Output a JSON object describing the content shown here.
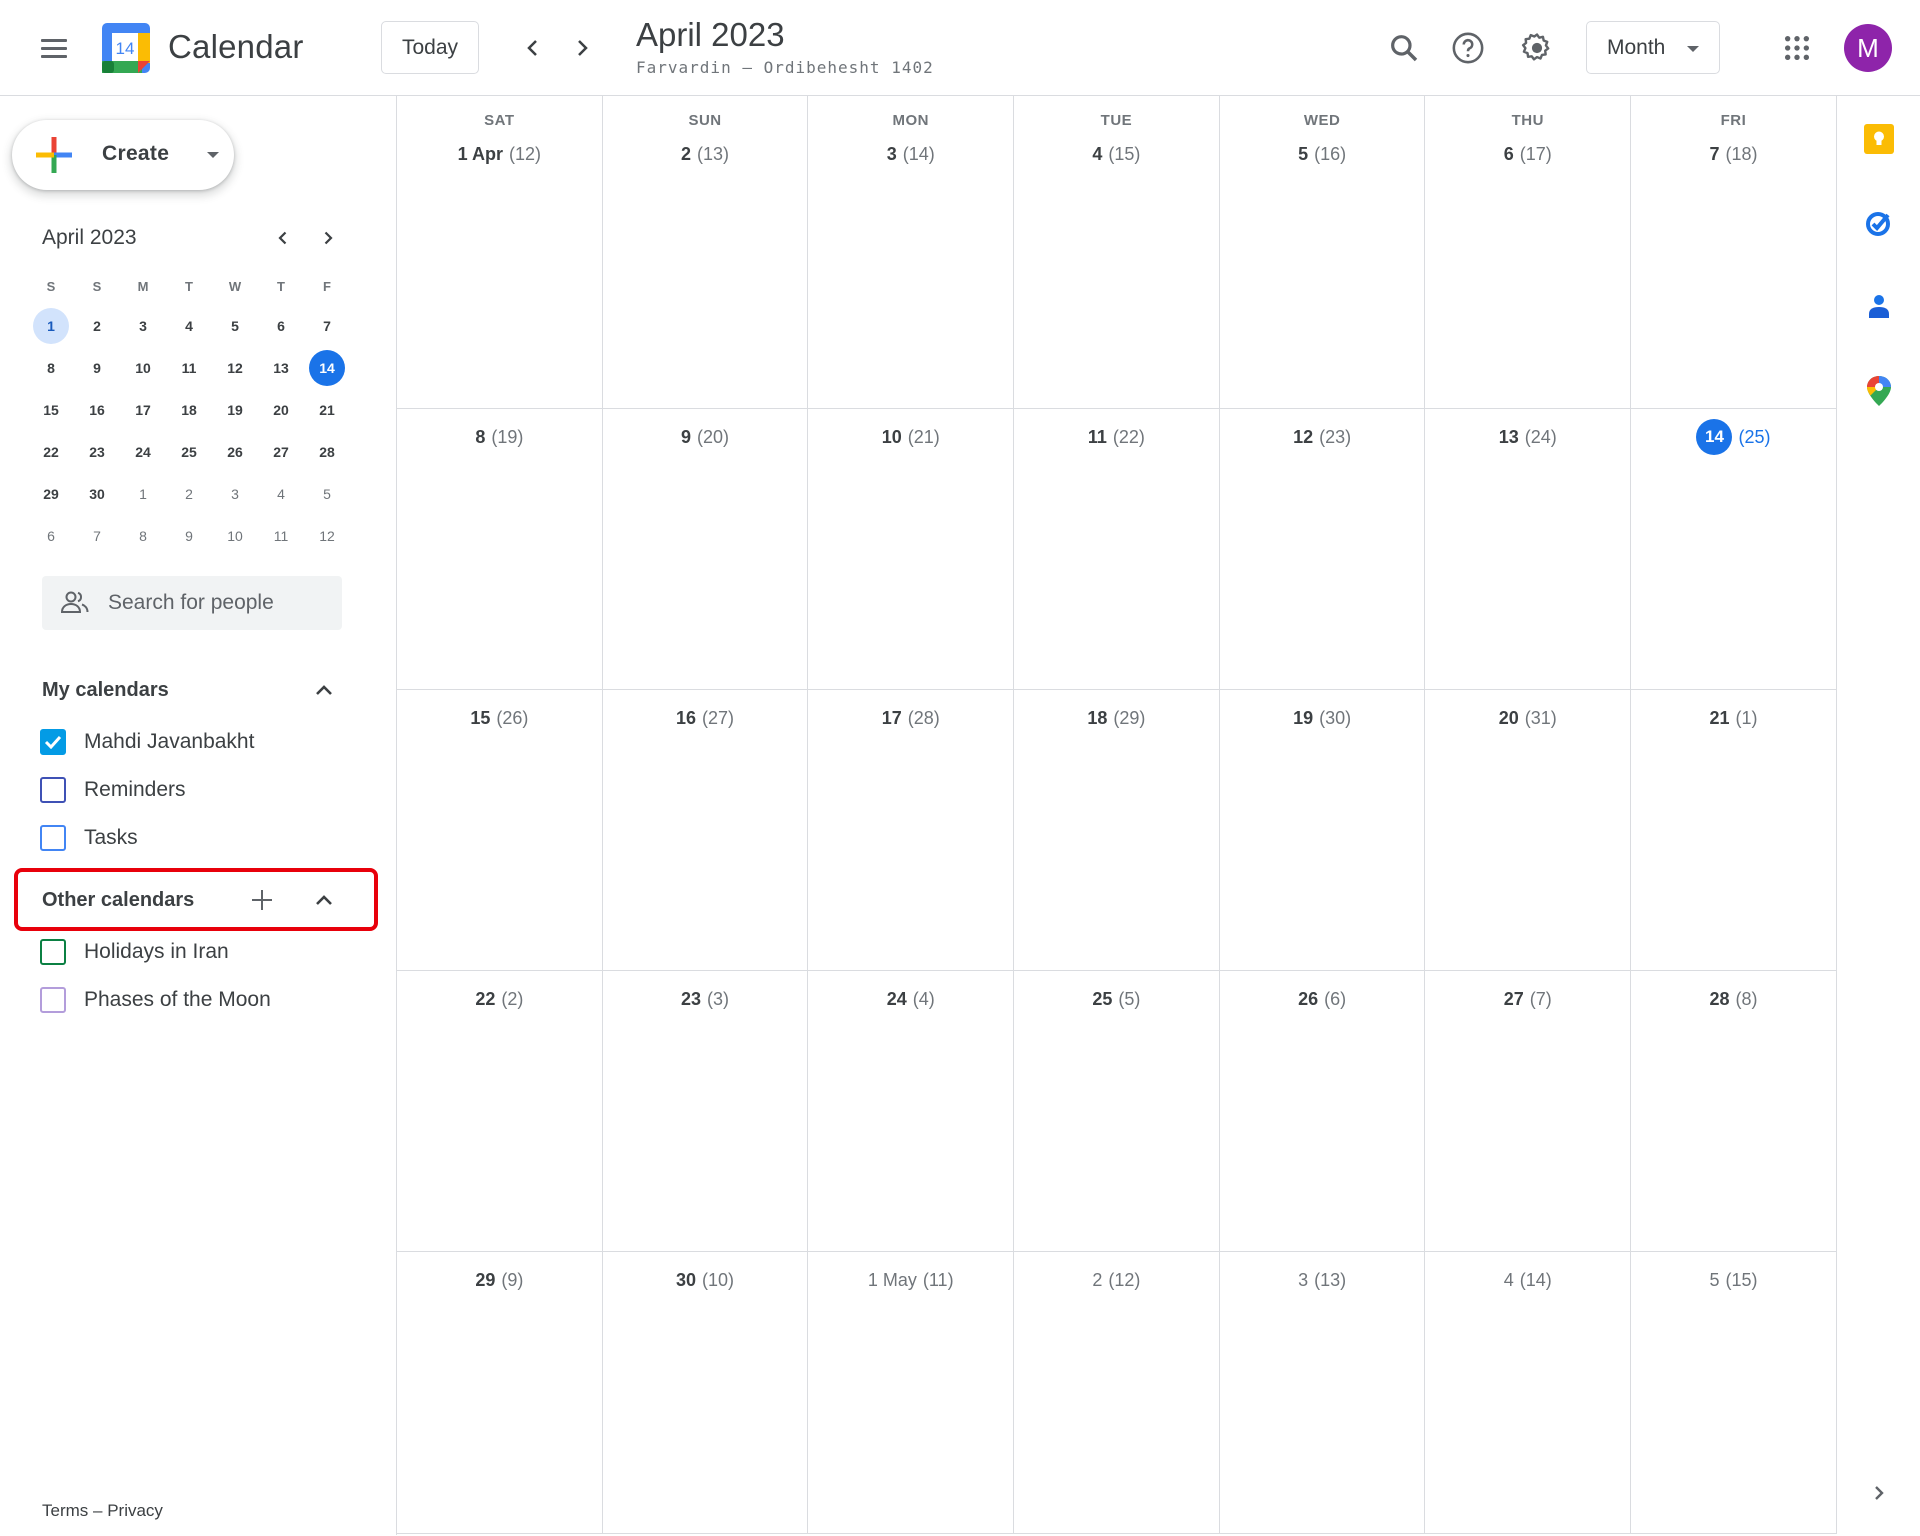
{
  "header": {
    "app_name": "Calendar",
    "logo_day": "14",
    "today_label": "Today",
    "title": "April 2023",
    "subtitle": "Farvardin – Ordibehesht 1402",
    "view_selector": "Month",
    "avatar_initial": "M",
    "icons": [
      "menu-icon",
      "chevron-left-icon",
      "chevron-right-icon",
      "search-icon",
      "help-icon",
      "settings-icon",
      "apps-grid-icon"
    ]
  },
  "sidebar": {
    "create_label": "Create",
    "mini_calendar": {
      "title": "April 2023",
      "weekday_headers": [
        "S",
        "S",
        "M",
        "T",
        "W",
        "T",
        "F"
      ],
      "weeks": [
        [
          {
            "d": "1",
            "state": "selected"
          },
          {
            "d": "2"
          },
          {
            "d": "3"
          },
          {
            "d": "4"
          },
          {
            "d": "5"
          },
          {
            "d": "6"
          },
          {
            "d": "7"
          }
        ],
        [
          {
            "d": "8"
          },
          {
            "d": "9"
          },
          {
            "d": "10"
          },
          {
            "d": "11"
          },
          {
            "d": "12"
          },
          {
            "d": "13"
          },
          {
            "d": "14",
            "state": "today"
          }
        ],
        [
          {
            "d": "15"
          },
          {
            "d": "16"
          },
          {
            "d": "17"
          },
          {
            "d": "18"
          },
          {
            "d": "19"
          },
          {
            "d": "20"
          },
          {
            "d": "21"
          }
        ],
        [
          {
            "d": "22"
          },
          {
            "d": "23"
          },
          {
            "d": "24"
          },
          {
            "d": "25"
          },
          {
            "d": "26"
          },
          {
            "d": "27"
          },
          {
            "d": "28"
          }
        ],
        [
          {
            "d": "29"
          },
          {
            "d": "30"
          },
          {
            "d": "1",
            "state": "other"
          },
          {
            "d": "2",
            "state": "other"
          },
          {
            "d": "3",
            "state": "other"
          },
          {
            "d": "4",
            "state": "other"
          },
          {
            "d": "5",
            "state": "other"
          }
        ],
        [
          {
            "d": "6",
            "state": "other"
          },
          {
            "d": "7",
            "state": "other"
          },
          {
            "d": "8",
            "state": "other"
          },
          {
            "d": "9",
            "state": "other"
          },
          {
            "d": "10",
            "state": "other"
          },
          {
            "d": "11",
            "state": "other"
          },
          {
            "d": "12",
            "state": "other"
          }
        ]
      ]
    },
    "people_search_placeholder": "Search for people",
    "my_calendars": {
      "label": "My calendars",
      "items": [
        {
          "name": "Mahdi Javanbakht",
          "checked": true,
          "color": "#039be5"
        },
        {
          "name": "Reminders",
          "checked": false,
          "color": "#3f51b5"
        },
        {
          "name": "Tasks",
          "checked": false,
          "color": "#4285f4"
        }
      ]
    },
    "other_calendars": {
      "label": "Other calendars",
      "items": [
        {
          "name": "Holidays in Iran",
          "checked": false,
          "color": "#0b8043"
        },
        {
          "name": "Phases of the Moon",
          "checked": false,
          "color": "#b39ddb"
        }
      ]
    },
    "footer": {
      "terms": "Terms",
      "separator": " – ",
      "privacy": "Privacy"
    }
  },
  "month_grid": {
    "weekday_headers": [
      "SAT",
      "SUN",
      "MON",
      "TUE",
      "WED",
      "THU",
      "FRI"
    ],
    "weeks": [
      [
        {
          "g": "1 Apr",
          "p": "(12)"
        },
        {
          "g": "2",
          "p": "(13)"
        },
        {
          "g": "3",
          "p": "(14)"
        },
        {
          "g": "4",
          "p": "(15)"
        },
        {
          "g": "5",
          "p": "(16)"
        },
        {
          "g": "6",
          "p": "(17)"
        },
        {
          "g": "7",
          "p": "(18)"
        }
      ],
      [
        {
          "g": "8",
          "p": "(19)"
        },
        {
          "g": "9",
          "p": "(20)"
        },
        {
          "g": "10",
          "p": "(21)"
        },
        {
          "g": "11",
          "p": "(22)"
        },
        {
          "g": "12",
          "p": "(23)"
        },
        {
          "g": "13",
          "p": "(24)"
        },
        {
          "g": "14",
          "p": "(25)",
          "state": "today"
        }
      ],
      [
        {
          "g": "15",
          "p": "(26)"
        },
        {
          "g": "16",
          "p": "(27)"
        },
        {
          "g": "17",
          "p": "(28)"
        },
        {
          "g": "18",
          "p": "(29)"
        },
        {
          "g": "19",
          "p": "(30)"
        },
        {
          "g": "20",
          "p": "(31)"
        },
        {
          "g": "21",
          "p": "(1)"
        }
      ],
      [
        {
          "g": "22",
          "p": "(2)"
        },
        {
          "g": "23",
          "p": "(3)"
        },
        {
          "g": "24",
          "p": "(4)"
        },
        {
          "g": "25",
          "p": "(5)"
        },
        {
          "g": "26",
          "p": "(6)"
        },
        {
          "g": "27",
          "p": "(7)"
        },
        {
          "g": "28",
          "p": "(8)"
        }
      ],
      [
        {
          "g": "29",
          "p": "(9)"
        },
        {
          "g": "30",
          "p": "(10)"
        },
        {
          "g": "1 May",
          "p": "(11)",
          "state": "other"
        },
        {
          "g": "2",
          "p": "(12)",
          "state": "other"
        },
        {
          "g": "3",
          "p": "(13)",
          "state": "other"
        },
        {
          "g": "4",
          "p": "(14)",
          "state": "other"
        },
        {
          "g": "5",
          "p": "(15)",
          "state": "other"
        }
      ]
    ]
  },
  "side_panel": {
    "apps": [
      {
        "name": "keep-icon",
        "color": "#fbbc04"
      },
      {
        "name": "tasks-icon",
        "color": "#1a73e8"
      },
      {
        "name": "contacts-icon",
        "color": "#1a73e8"
      },
      {
        "name": "maps-icon",
        "color": "#34a853"
      }
    ]
  },
  "colors": {
    "accent": "#1a73e8",
    "highlight_box": "#e8000b",
    "avatar": "#8e24aa"
  }
}
